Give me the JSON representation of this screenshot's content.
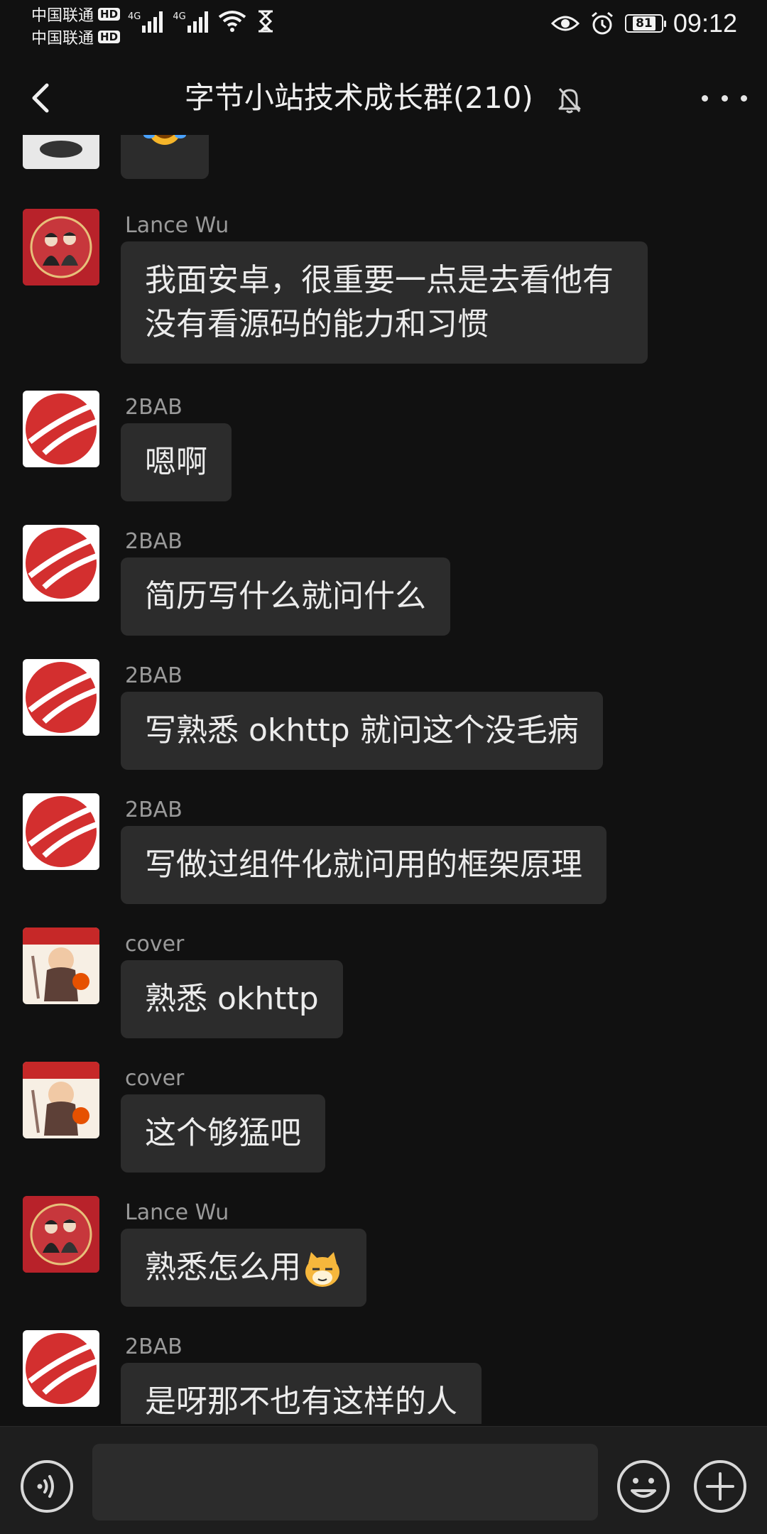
{
  "status_bar": {
    "carrier_1": "中国联通",
    "carrier_2": "中国联通",
    "hd_label": "HD",
    "net_1": "4G",
    "net_2": "4G",
    "battery": "81",
    "time": "09:12"
  },
  "header": {
    "title": "字节小站技术成长群(210)"
  },
  "messages": [
    {
      "sender": "Lance Wu",
      "text": "我面安卓，很重要一点是去看他有没有看源码的能力和习惯"
    },
    {
      "sender": "2BAB",
      "text": "嗯啊"
    },
    {
      "sender": "2BAB",
      "text": "简历写什么就问什么"
    },
    {
      "sender": "2BAB",
      "text": "写熟悉 okhttp 就问这个没毛病"
    },
    {
      "sender": "2BAB",
      "text": "写做过组件化就问用的框架原理"
    },
    {
      "sender": "cover",
      "text": "熟悉 okhttp"
    },
    {
      "sender": "cover",
      "text": "这个够猛吧"
    },
    {
      "sender": "Lance Wu",
      "text": "熟悉怎么用"
    },
    {
      "sender": "2BAB",
      "text": "是呀那不也有这样的人"
    }
  ],
  "input": {
    "value": ""
  },
  "colors": {
    "background": "#111111",
    "bubble": "#2c2c2c",
    "sender_name": "#9a9a9a",
    "accent_red": "#d32f2f"
  }
}
